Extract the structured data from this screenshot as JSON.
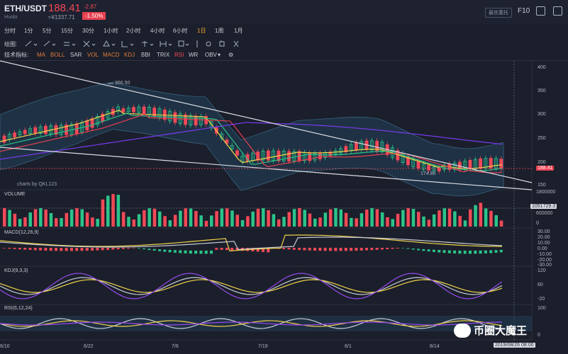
{
  "header": {
    "pair": "ETH/USDT",
    "exchange": "Huobi",
    "price": "188.41",
    "price_cny": "≈¥1337.71",
    "change": "-2.87",
    "change_pct": "-1.50%",
    "btn_latest": "最优委托",
    "f10": "F10"
  },
  "intervals": [
    "分时",
    "1分",
    "5分",
    "15分",
    "30分",
    "1小时",
    "2小时",
    "4小时",
    "6小时",
    "1日",
    "1周",
    "1月"
  ],
  "active_interval": "1日",
  "draw": {
    "label": "绘图:"
  },
  "indicators": {
    "label": "技术指标:",
    "items": [
      "MA",
      "BOLL",
      "SAR",
      "VOL",
      "MACD",
      "KDJ",
      "BBI",
      "TRIX",
      "RSI",
      "WR",
      "OBV"
    ]
  },
  "main": {
    "max_label": "366.50",
    "min_label": "174.80",
    "price_tag": "188.41",
    "credit": "charts by QKL123",
    "yticks": [
      "400",
      "350",
      "300",
      "250",
      "200",
      "150"
    ]
  },
  "volume": {
    "title": "VOLUME",
    "ticks": [
      "1800000",
      "600000",
      "0"
    ],
    "tag": "1051729.3"
  },
  "macd": {
    "title": "MACD(12,26,9)",
    "ticks": [
      "30.00",
      "20.00",
      "10.00",
      "0.00",
      "-10.00",
      "-20.00",
      "-30.00"
    ]
  },
  "kdj": {
    "title": "KDJ(9,3,3)",
    "ticks": [
      "120",
      "60",
      "-20"
    ]
  },
  "rsi": {
    "title": "RSI(6,12,24)",
    "ticks": [
      "100",
      "0"
    ]
  },
  "xaxis": {
    "dates": [
      "6/10",
      "6/22",
      "7/6",
      "7/19",
      "8/1",
      "8/14"
    ],
    "cursor": "2019/08/26 08:00"
  },
  "watermark": {
    "text": "币圈大魔王"
  },
  "colors": {
    "up": "#2bc48a",
    "down": "#f24957",
    "accent": "#f0a82a",
    "bg": "#1b1f2b"
  }
}
